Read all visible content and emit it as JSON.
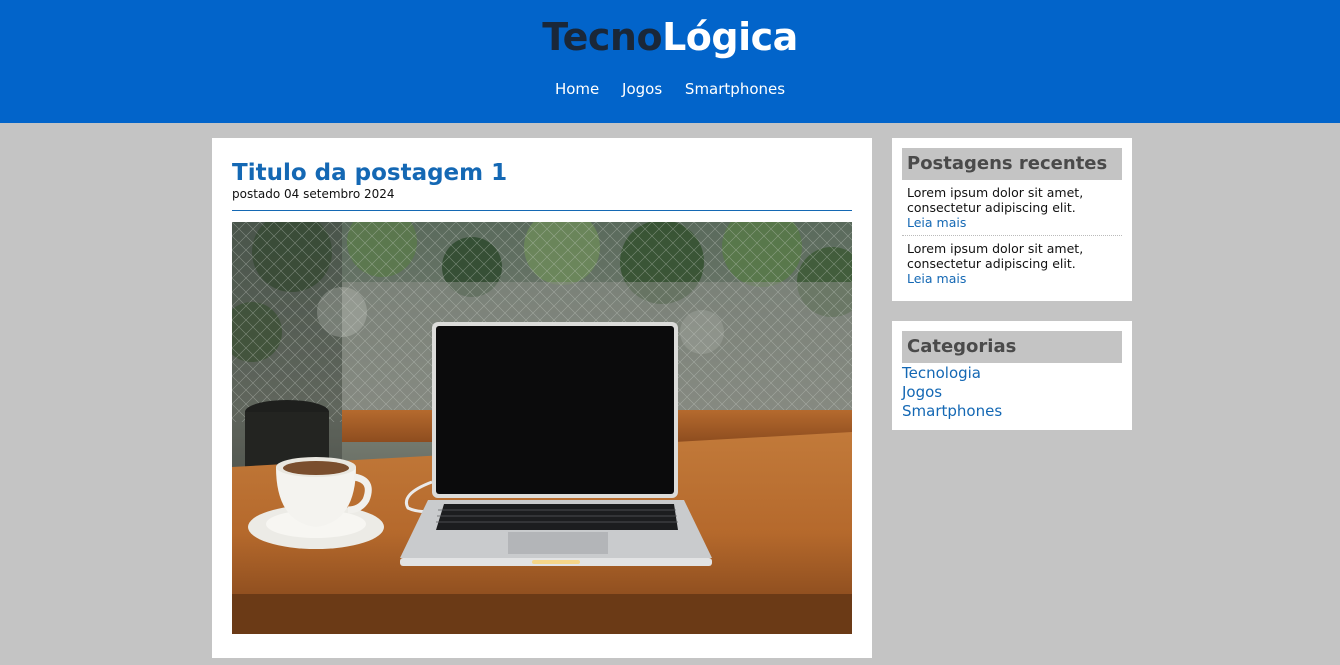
{
  "site": {
    "logo_part1": "Tecno",
    "logo_part2": "Lógica"
  },
  "nav": {
    "items": [
      {
        "label": "Home"
      },
      {
        "label": "Jogos"
      },
      {
        "label": "Smartphones"
      }
    ]
  },
  "post": {
    "title": "Titulo da postagem 1",
    "date": "postado 04 setembro 2024"
  },
  "recent": {
    "heading": "Postagens recentes",
    "items": [
      {
        "text": "Lorem ipsum dolor sit amet, consectetur adipiscing elit.",
        "link": "Leia mais"
      },
      {
        "text": "Lorem ipsum dolor sit amet, consectetur adipiscing elit.",
        "link": "Leia mais"
      }
    ]
  },
  "categories": {
    "heading": "Categorias",
    "items": [
      {
        "label": "Tecnologia"
      },
      {
        "label": "Jogos"
      },
      {
        "label": "Smartphones"
      }
    ]
  },
  "colors": {
    "header_bg": "#0264ca",
    "page_bg": "#c4c4c4",
    "link": "#1468b4",
    "logo_dark": "#1a2738"
  }
}
